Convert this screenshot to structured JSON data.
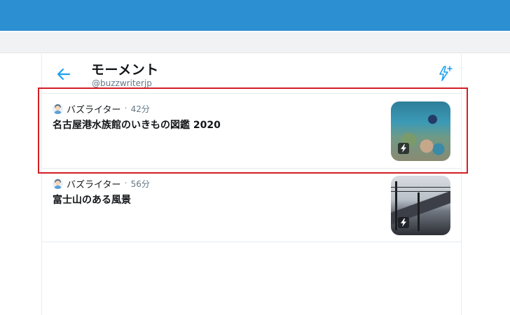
{
  "colors": {
    "topbar": "#2b8fd2",
    "accent": "#1da1f2",
    "highlight": "#d21f25"
  },
  "header": {
    "title": "モーメント",
    "handle": "@buzzwriterjp",
    "back_icon": "arrow-left-icon",
    "create_icon": "lightning-plus-icon"
  },
  "moments": [
    {
      "author": "バズライター",
      "separator": "·",
      "time": "42分",
      "title": "名古屋港水族館のいきもの図鑑 2020",
      "thumbnail": "aquarium-thumbnail"
    },
    {
      "author": "バズライター",
      "separator": "·",
      "time": "56分",
      "title": "富士山のある風景",
      "thumbnail": "mount-fuji-thumbnail"
    }
  ]
}
